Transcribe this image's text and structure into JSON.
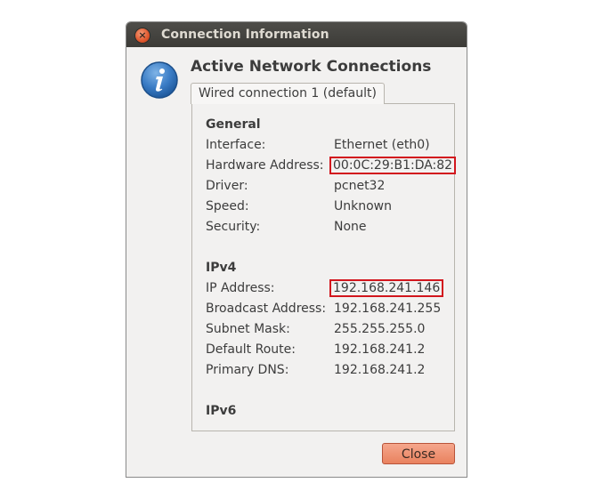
{
  "window": {
    "title": "Connection Information",
    "close_icon": "close-icon",
    "close_glyph": "×"
  },
  "dialog": {
    "info_icon": "info-icon",
    "heading": "Active Network Connections",
    "tab_label": "Wired connection 1 (default)"
  },
  "general": {
    "title": "General",
    "rows": [
      {
        "label": "Interface:",
        "value": "Ethernet (eth0)"
      },
      {
        "label": "Hardware Address:",
        "value": "00:0C:29:B1:DA:82"
      },
      {
        "label": "Driver:",
        "value": "pcnet32"
      },
      {
        "label": "Speed:",
        "value": "Unknown"
      },
      {
        "label": "Security:",
        "value": "None"
      }
    ]
  },
  "ipv4": {
    "title": "IPv4",
    "rows": [
      {
        "label": "IP Address:",
        "value": "192.168.241.146"
      },
      {
        "label": "Broadcast Address:",
        "value": "192.168.241.255"
      },
      {
        "label": "Subnet Mask:",
        "value": "255.255.255.0"
      },
      {
        "label": "Default Route:",
        "value": "192.168.241.2"
      },
      {
        "label": "Primary DNS:",
        "value": "192.168.241.2"
      }
    ]
  },
  "ipv6": {
    "title": "IPv6"
  },
  "buttons": {
    "close_label": "Close"
  },
  "colors": {
    "titlebar": "#3c3b37",
    "highlight_box": "#d2161d",
    "close_button": "#e9825f"
  }
}
